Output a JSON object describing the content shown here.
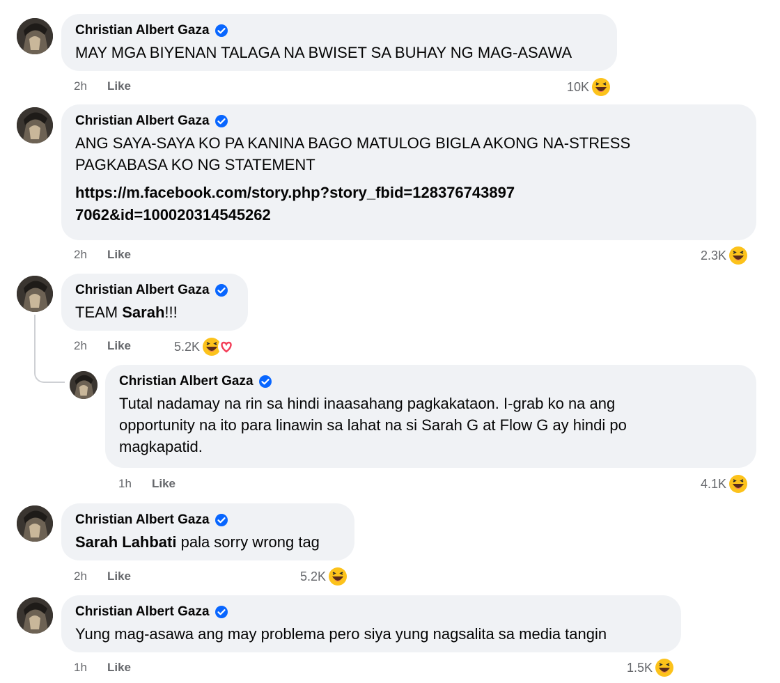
{
  "author_name": "Christian Albert Gaza",
  "like_label": "Like",
  "comments": [
    {
      "id": "c1",
      "lines": [
        "MAY MGA BIYENAN TALAGA NA BWISET SA BUHAY NG MAG-ASAWA"
      ],
      "time": "2h",
      "reaction_count": "10K"
    },
    {
      "id": "c2",
      "lines": [
        "ANG SAYA-SAYA KO PA KANINA BAGO MATULOG BIGLA AKONG NA-STRESS",
        "PAGKABASA KO NG STATEMENT"
      ],
      "link": "https://m.facebook.com/story.php?story_fbid=1283767438977062&id=100020314545262",
      "time": "2h",
      "reaction_count": "2.3K"
    },
    {
      "id": "c3",
      "text_before": "TEAM ",
      "mention": "Sarah",
      "text_after": "!!!",
      "time": "2h",
      "reaction_count": "5.2K"
    },
    {
      "id": "c4",
      "lines": [
        "Tutal nadamay na rin sa hindi inaasahang pagkakataon. I-grab ko na ang",
        "opportunity na ito para linawin sa lahat na si Sarah G at Flow G ay hindi po",
        "magkapatid."
      ],
      "time": "1h",
      "reaction_count": "4.1K"
    },
    {
      "id": "c5",
      "mention": "Sarah Lahbati",
      "text_after": " pala sorry wrong tag",
      "time": "2h",
      "reaction_count": "5.2K"
    },
    {
      "id": "c6",
      "lines": [
        "Yung mag-asawa ang may problema pero siya yung nagsalita sa media tangin"
      ],
      "time": "1h",
      "reaction_count": "1.5K"
    }
  ],
  "colors": {
    "bubble": "#f0f2f5",
    "verified": "#0866ff",
    "meta_text": "#65676b",
    "emoji_yellow": "#fcc21b",
    "heart": "#f33e58"
  },
  "icons": [
    "avatar",
    "verified-badge-icon",
    "haha-emoji-icon",
    "love-heart-icon"
  ]
}
